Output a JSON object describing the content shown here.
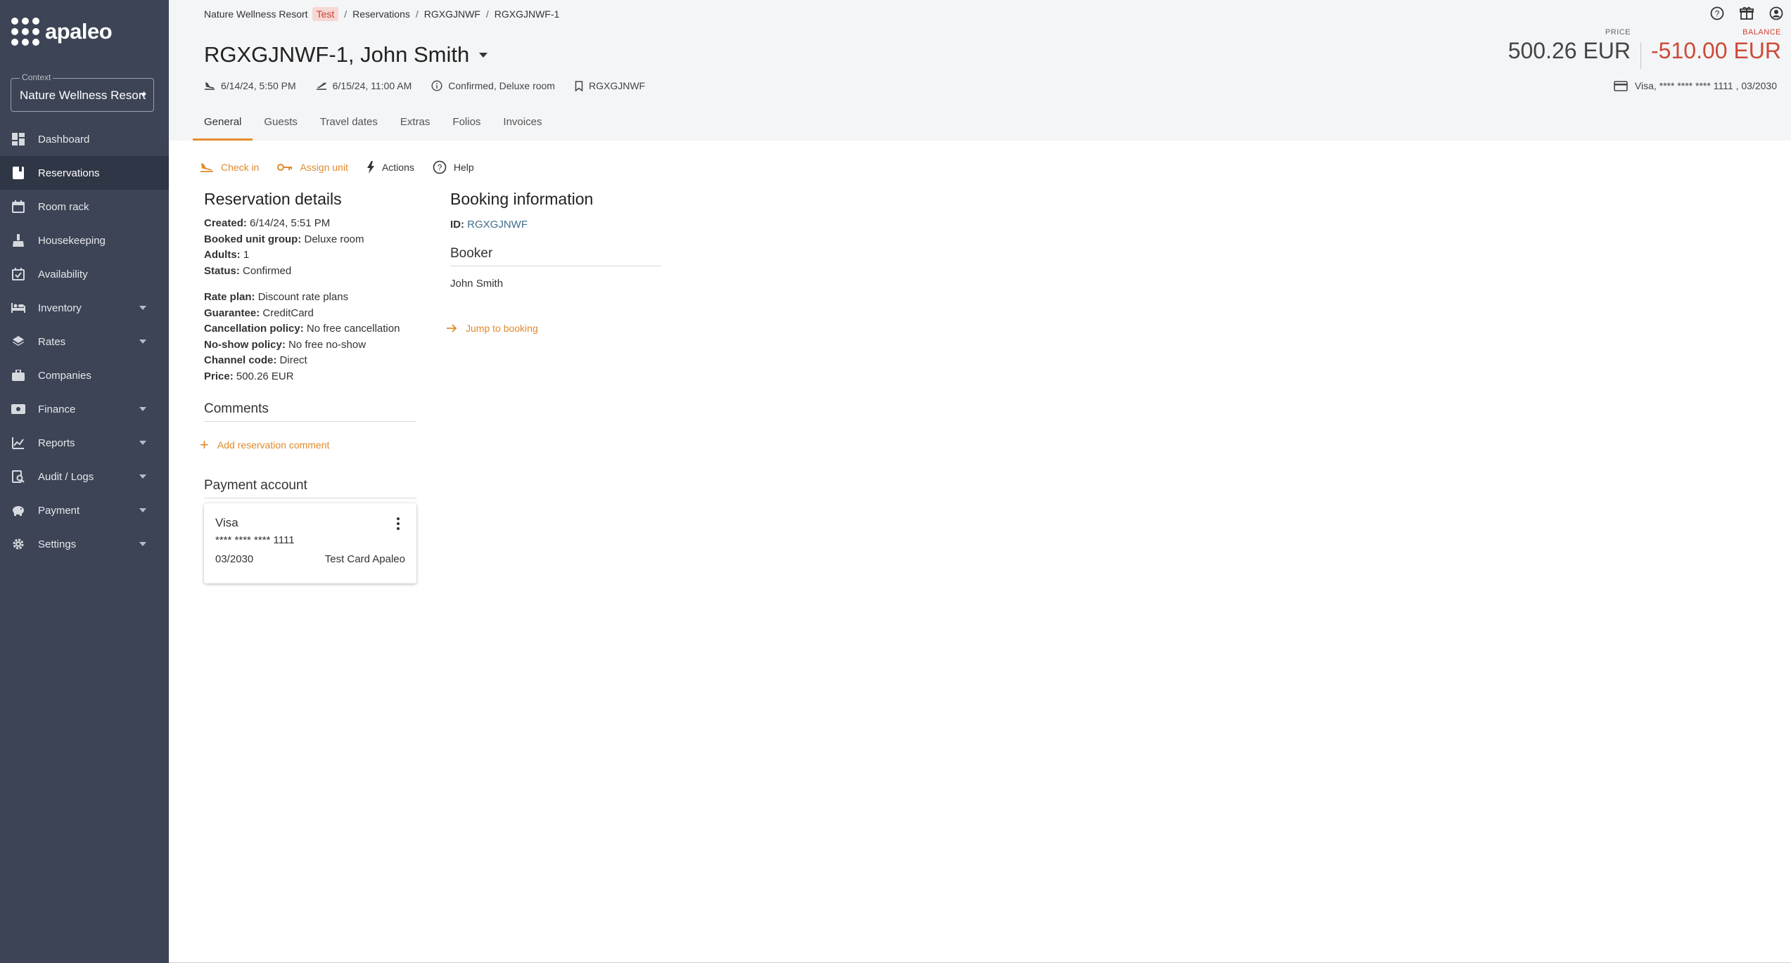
{
  "app": {
    "logo_text": "apaleo",
    "context_label": "Context",
    "context_value": "Nature Wellness Resort"
  },
  "sidebar": {
    "items": [
      {
        "label": "Dashboard",
        "icon": "dashboard-icon",
        "active": false,
        "expandable": false
      },
      {
        "label": "Reservations",
        "icon": "reservations-icon",
        "active": true,
        "expandable": false
      },
      {
        "label": "Room rack",
        "icon": "calendar-icon",
        "active": false,
        "expandable": false
      },
      {
        "label": "Housekeeping",
        "icon": "broom-icon",
        "active": false,
        "expandable": false
      },
      {
        "label": "Availability",
        "icon": "calendar-check-icon",
        "active": false,
        "expandable": false
      },
      {
        "label": "Inventory",
        "icon": "bed-icon",
        "active": false,
        "expandable": true
      },
      {
        "label": "Rates",
        "icon": "layers-icon",
        "active": false,
        "expandable": true
      },
      {
        "label": "Companies",
        "icon": "briefcase-icon",
        "active": false,
        "expandable": false
      },
      {
        "label": "Finance",
        "icon": "money-icon",
        "active": false,
        "expandable": true
      },
      {
        "label": "Reports",
        "icon": "chart-icon",
        "active": false,
        "expandable": true
      },
      {
        "label": "Audit / Logs",
        "icon": "audit-icon",
        "active": false,
        "expandable": true
      },
      {
        "label": "Payment",
        "icon": "piggy-bank-icon",
        "active": false,
        "expandable": true
      },
      {
        "label": "Settings",
        "icon": "gear-icon",
        "active": false,
        "expandable": true
      }
    ]
  },
  "breadcrumb": {
    "property": "Nature Wellness Resort",
    "badge": "Test",
    "reservations": "Reservations",
    "booking": "RGXGJNWF",
    "reservation": "RGXGJNWF-1"
  },
  "header": {
    "title": "RGXGJNWF-1, John Smith",
    "arrival": "6/14/24, 5:50 PM",
    "departure": "6/15/24, 11:00 AM",
    "status": "Confirmed, Deluxe room",
    "booking_id": "RGXGJNWF",
    "price_label": "PRICE",
    "price_value": "500.26 EUR",
    "balance_label": "BALANCE",
    "balance_value": "-510.00 EUR",
    "card_info": "Visa, **** **** **** 1111 , 03/2030"
  },
  "tabs": [
    "General",
    "Guests",
    "Travel dates",
    "Extras",
    "Folios",
    "Invoices"
  ],
  "actions": {
    "check_in": "Check in",
    "assign_unit": "Assign unit",
    "actions": "Actions",
    "help": "Help"
  },
  "reservation_details": {
    "title": "Reservation details",
    "fields_a": [
      {
        "label": "Created:",
        "value": "6/14/24, 5:51 PM"
      },
      {
        "label": "Booked unit group:",
        "value": "Deluxe room"
      },
      {
        "label": "Adults:",
        "value": "1"
      },
      {
        "label": "Status:",
        "value": "Confirmed"
      }
    ],
    "fields_b": [
      {
        "label": "Rate plan:",
        "value": "Discount rate plans"
      },
      {
        "label": "Guarantee:",
        "value": "CreditCard"
      },
      {
        "label": "Cancellation policy:",
        "value": "No free cancellation"
      },
      {
        "label": "No-show policy:",
        "value": "No free no-show"
      },
      {
        "label": "Channel code:",
        "value": "Direct"
      },
      {
        "label": "Price:",
        "value": "500.26 EUR"
      }
    ],
    "comments_title": "Comments",
    "add_comment": "Add reservation comment",
    "payment_title": "Payment account"
  },
  "payment_card": {
    "brand": "Visa",
    "number": "**** **** **** 1111",
    "expiry": "03/2030",
    "holder": "Test Card Apaleo"
  },
  "booking_info": {
    "title": "Booking information",
    "id_label": "ID:",
    "id_value": "RGXGJNWF",
    "booker_title": "Booker",
    "booker_name": "John Smith",
    "jump": "Jump to booking"
  }
}
